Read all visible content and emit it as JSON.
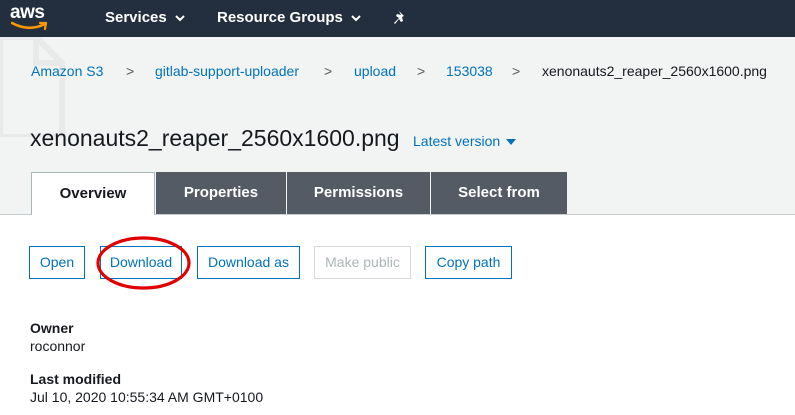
{
  "topnav": {
    "logo_text": "aws",
    "items": [
      {
        "label": "Services"
      },
      {
        "label": "Resource Groups"
      }
    ]
  },
  "breadcrumb": {
    "items": [
      "Amazon S3",
      "gitlab-support-uploader",
      "upload",
      "153038"
    ],
    "separator": ">",
    "current": "xenonauts2_reaper_2560x1600.png"
  },
  "object": {
    "title": "xenonauts2_reaper_2560x1600.png",
    "version_label": "Latest version"
  },
  "tabs": [
    {
      "label": "Overview",
      "active": true
    },
    {
      "label": "Properties",
      "active": false
    },
    {
      "label": "Permissions",
      "active": false
    },
    {
      "label": "Select from",
      "active": false
    }
  ],
  "actions": [
    {
      "label": "Open",
      "enabled": true
    },
    {
      "label": "Download",
      "enabled": true
    },
    {
      "label": "Download as",
      "enabled": true
    },
    {
      "label": "Make public",
      "enabled": false
    },
    {
      "label": "Copy path",
      "enabled": true
    }
  ],
  "details": {
    "owner_label": "Owner",
    "owner_value": "roconnor",
    "modified_label": "Last modified",
    "modified_value": "Jul 10, 2020 10:55:34 AM GMT+0100"
  },
  "colors": {
    "nav_bg": "#232f3e",
    "link": "#0073bb",
    "tab_inactive": "#545b64",
    "annotation": "#e00000"
  },
  "annotation": {
    "shape": "ellipse",
    "target": "Download"
  }
}
